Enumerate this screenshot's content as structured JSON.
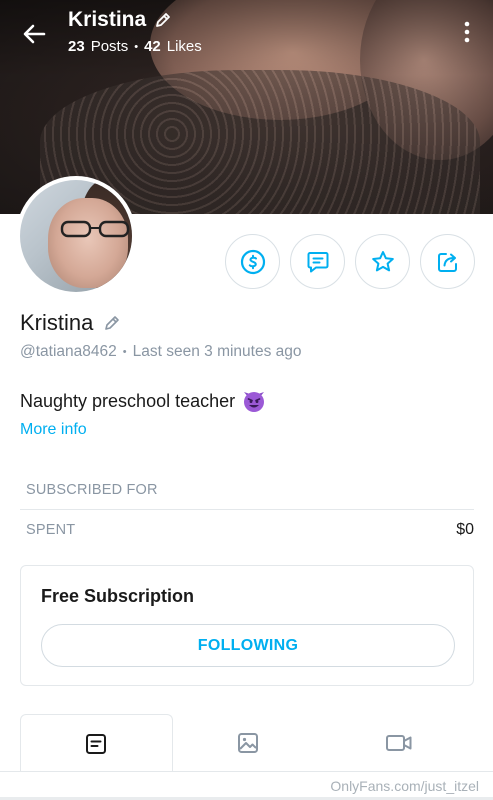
{
  "header": {
    "title": "Kristina",
    "posts_count": "23",
    "posts_label": "Posts",
    "likes_count": "42",
    "likes_label": "Likes",
    "separator": "•"
  },
  "profile": {
    "name": "Kristina",
    "handle": "@tatiana8462",
    "separator": "•",
    "last_seen": "Last seen 3 minutes ago",
    "bio": "Naughty preschool teacher",
    "more_info": "More info"
  },
  "actions": [
    "tip-icon",
    "message-icon",
    "star-icon",
    "share-icon"
  ],
  "stats": [
    {
      "label": "SUBSCRIBED FOR",
      "value": ""
    },
    {
      "label": "SPENT",
      "value": "$0"
    }
  ],
  "subscription": {
    "title": "Free Subscription",
    "button": "FOLLOWING"
  },
  "tabs": [
    "posts-icon",
    "media-icon",
    "video-icon"
  ],
  "watermark": "OnlyFans.com/just_itzel",
  "colors": {
    "accent": "#00aff0",
    "muted": "#8a96a3",
    "border": "#e4e8eb"
  }
}
